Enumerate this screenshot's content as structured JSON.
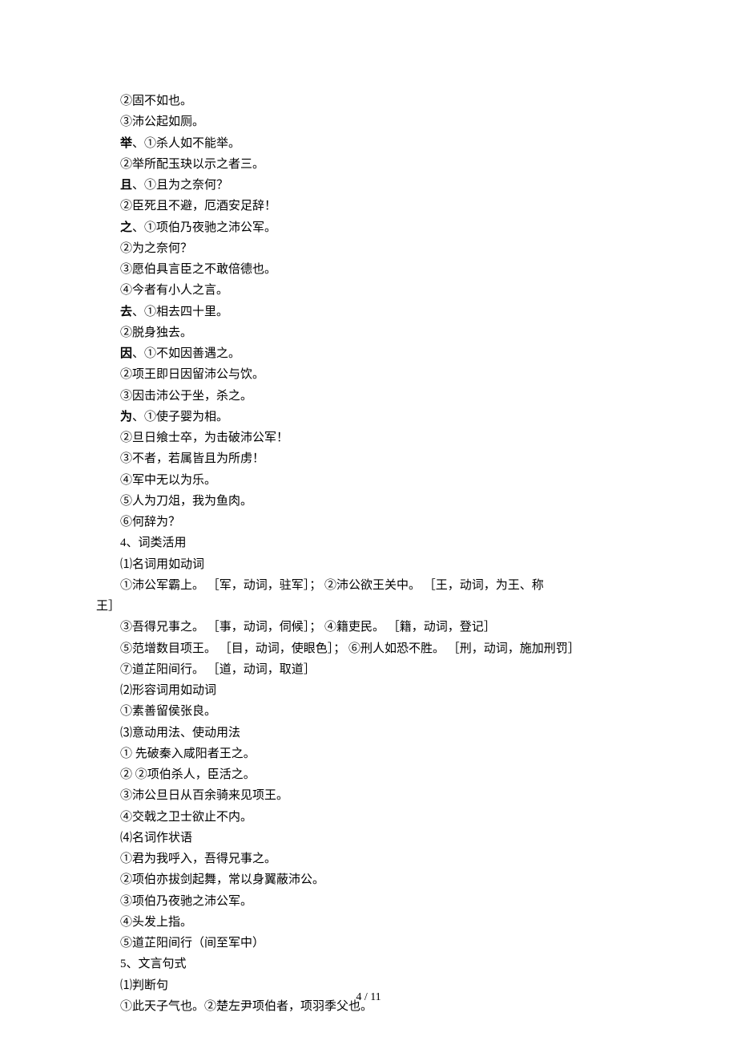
{
  "lines": [
    {
      "t": "②固不如也。",
      "i": true
    },
    {
      "t": "③沛公起如厕。",
      "i": true
    },
    {
      "lead": "举",
      "t": "、①杀人如不能举。",
      "i": true
    },
    {
      "t": "②举所配玉玦以示之者三。",
      "i": true
    },
    {
      "lead": "且",
      "t": "、①且为之奈何？",
      "i": true
    },
    {
      "t": "②臣死且不避，厄酒安足辞！",
      "i": true
    },
    {
      "lead": "之",
      "t": "、①项伯乃夜驰之沛公军。",
      "i": true
    },
    {
      "t": "②为之奈何？",
      "i": true
    },
    {
      "t": "③愿伯具言臣之不敢倍德也。",
      "i": true
    },
    {
      "t": "④今者有小人之言。",
      "i": true
    },
    {
      "lead": "去",
      "t": "、①相去四十里。",
      "i": true
    },
    {
      "t": "②脱身独去。",
      "i": true
    },
    {
      "lead": "因",
      "t": "、①不如因善遇之。",
      "i": true
    },
    {
      "t": "②项王即日因留沛公与饮。",
      "i": true
    },
    {
      "t": "③因击沛公于坐，杀之。",
      "i": true
    },
    {
      "lead": "为",
      "t": "、①使子婴为相。",
      "i": true
    },
    {
      "t": "②旦日飨士卒，为击破沛公军！",
      "i": true
    },
    {
      "t": "③不者，若属皆且为所虏！",
      "i": true
    },
    {
      "t": "④军中无以为乐。",
      "i": true
    },
    {
      "t": "⑤人为刀俎，我为鱼肉。",
      "i": true
    },
    {
      "t": "⑥何辞为？",
      "i": true
    },
    {
      "t": "4、词类活用",
      "i": true
    },
    {
      "t": "⑴名词用如动词",
      "i": true
    },
    {
      "t": "①沛公军霸上。   ［军，动词，驻军］；       ②沛公欲王关中。 ［王，动词，为王、称",
      "i": true
    },
    {
      "t": "王］",
      "i": false
    },
    {
      "t": "③吾得兄事之。   ［事，动词，伺候］；       ④籍吏民。           ［籍，动词，登记］",
      "i": true
    },
    {
      "t": "⑤范增数目项王。 ［目，动词，使眼色］；   ⑥刑人如恐不胜。 ［刑，动词，施加刑罚］",
      "i": true
    },
    {
      "t": "⑦道芷阳间行。   ［道，动词，取道］",
      "i": true
    },
    {
      "t": "⑵形容词用如动词",
      "i": true
    },
    {
      "t": "①素善留侯张良。",
      "i": true
    },
    {
      "t": "⑶意动用法、使动用法",
      "i": true
    },
    {
      "t": "①   先破秦入咸阳者王之。",
      "i": true
    },
    {
      "t": "②   ②项伯杀人，臣活之。",
      "i": true
    },
    {
      "t": "③沛公旦日从百余骑来见项王。",
      "i": true
    },
    {
      "t": "④交戟之卫士欲止不内。",
      "i": true
    },
    {
      "t": "⑷名词作状语",
      "i": true
    },
    {
      "t": "①君为我呼入，吾得兄事之。",
      "i": true
    },
    {
      "t": "②项伯亦拔剑起舞，常以身翼蔽沛公。",
      "i": true
    },
    {
      "t": "③项伯乃夜驰之沛公军。",
      "i": true
    },
    {
      "t": "④头发上指。",
      "i": true
    },
    {
      "t": "⑤道芷阳间行（间至军中）",
      "i": true
    },
    {
      "t": "5、文言句式",
      "i": true
    },
    {
      "t": "⑴判断句",
      "i": true
    },
    {
      "t": "①此天子气也。②楚左尹项伯者，项羽季父也。",
      "i": true
    }
  ],
  "footer": "4  /  11"
}
